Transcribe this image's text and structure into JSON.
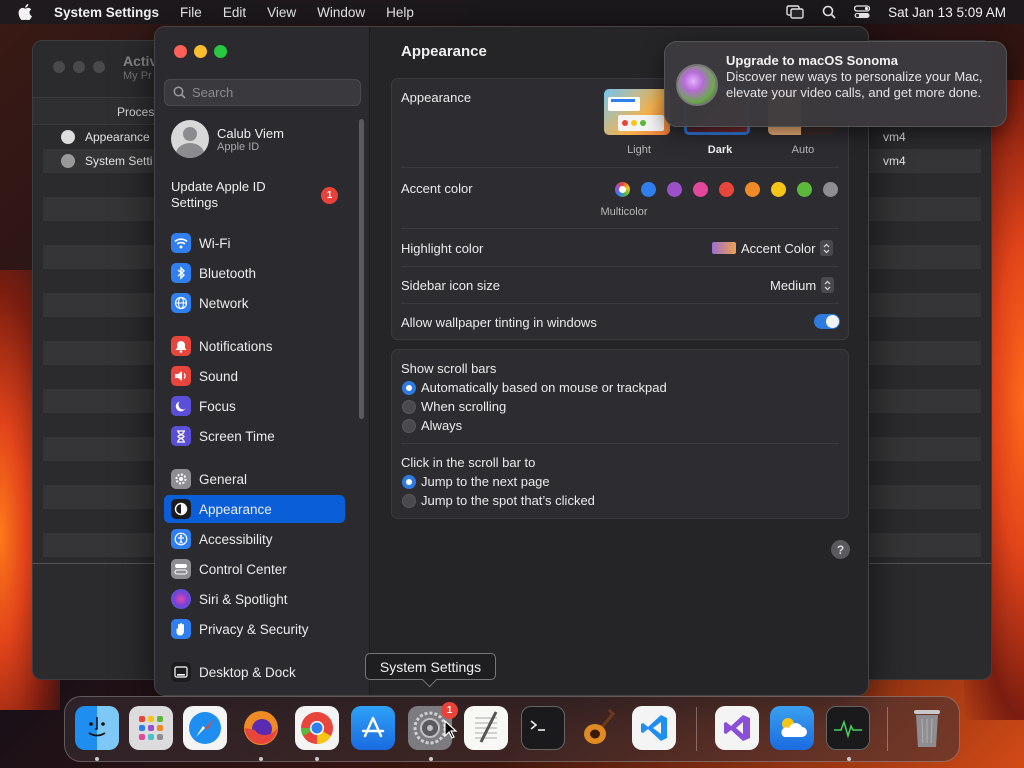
{
  "menubar": {
    "app": "System Settings",
    "items": [
      "File",
      "Edit",
      "View",
      "Window",
      "Help"
    ],
    "datetime": "Sat Jan 13  5:09 AM"
  },
  "activity": {
    "title": "Activ",
    "subtitle": "My Pr",
    "column": "Proces",
    "rows": [
      {
        "name": "Appearance",
        "user": "vm4"
      },
      {
        "name": "System Setti",
        "user": "vm4"
      }
    ]
  },
  "sidebar": {
    "search_placeholder": "Search",
    "profile": {
      "name": "Calub Viem",
      "sub": "Apple ID"
    },
    "update": {
      "label": "Update Apple ID Settings",
      "badge": "1"
    },
    "items": [
      {
        "label": "Wi-Fi",
        "color": "#2f7ff0"
      },
      {
        "label": "Bluetooth",
        "color": "#2f7ff0"
      },
      {
        "label": "Network",
        "color": "#2f7ff0"
      },
      {
        "label": "Notifications",
        "color": "#e8453c"
      },
      {
        "label": "Sound",
        "color": "#e8453c"
      },
      {
        "label": "Focus",
        "color": "#5a4fd6"
      },
      {
        "label": "Screen Time",
        "color": "#5a4fd6"
      },
      {
        "label": "General",
        "color": "#8e8e92"
      },
      {
        "label": "Appearance",
        "color": "#1c1c1e"
      },
      {
        "label": "Accessibility",
        "color": "#2f7ff0"
      },
      {
        "label": "Control Center",
        "color": "#8e8e92"
      },
      {
        "label": "Siri & Spotlight",
        "color": "#b04ad8"
      },
      {
        "label": "Privacy & Security",
        "color": "#2f7ff0"
      },
      {
        "label": "Desktop & Dock",
        "color": "#1c1c1e"
      }
    ]
  },
  "main": {
    "title": "Appearance",
    "appearance_label": "Appearance",
    "modes": [
      "Light",
      "Dark",
      "Auto"
    ],
    "accent_label": "Accent color",
    "accent_caption": "Multicolor",
    "accent_colors": [
      "#2f7ff0",
      "#9b50c8",
      "#e2479b",
      "#e8453c",
      "#f08a24",
      "#f5c518",
      "#5cb83a",
      "#8e8e92"
    ],
    "highlight_label": "Highlight color",
    "highlight_value": "Accent Color",
    "icon_size_label": "Sidebar icon size",
    "icon_size_value": "Medium",
    "tinting_label": "Allow wallpaper tinting in windows",
    "scroll_label": "Show scroll bars",
    "scroll_options": [
      "Automatically based on mouse or trackpad",
      "When scrolling",
      "Always"
    ],
    "click_label": "Click in the scroll bar to",
    "click_options": [
      "Jump to the next page",
      "Jump to the spot that’s clicked"
    ],
    "help": "?"
  },
  "notification": {
    "title": "Upgrade to macOS Sonoma",
    "body": "Discover new ways to personalize your Mac, elevate your video calls, and get more done."
  },
  "tooltip": "System Settings",
  "dock": {
    "badge": "1",
    "apps": [
      "finder-icon",
      "launchpad-icon",
      "safari-icon",
      "firefox-icon",
      "chrome-icon",
      "app-store-icon",
      "system-settings-icon",
      "textedit-icon",
      "terminal-icon",
      "garageband-icon",
      "vscode-icon",
      "visual-studio-icon",
      "weather-icon",
      "activity-monitor-icon",
      "trash-icon"
    ]
  }
}
